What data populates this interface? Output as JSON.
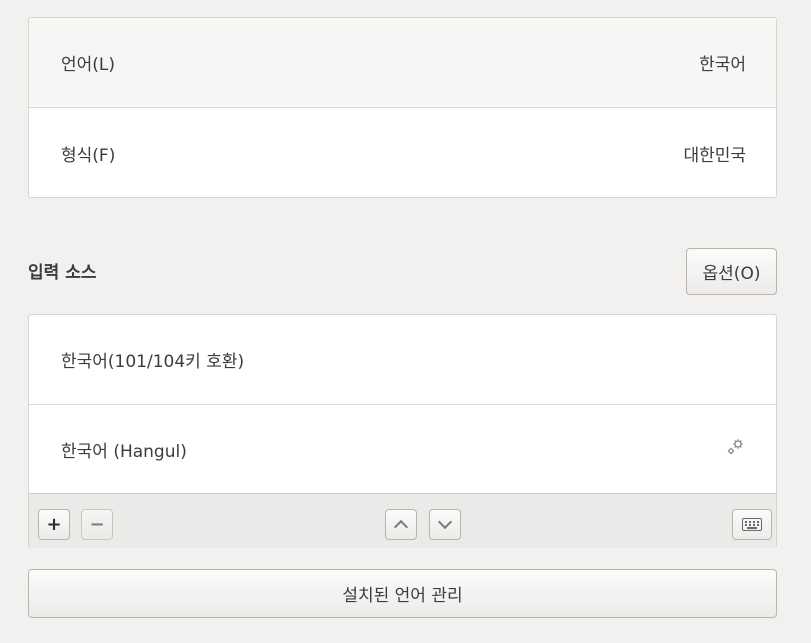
{
  "region": {
    "rows": [
      {
        "label": "언어(L)",
        "value": "한국어"
      },
      {
        "label": "형식(F)",
        "value": "대한민국"
      }
    ]
  },
  "input_sources": {
    "heading": "입력 소스",
    "options_label": "옵션(O)",
    "items": [
      {
        "label": "한국어(101/104키 호환)",
        "icon": "none"
      },
      {
        "label": "한국어 (Hangul)",
        "icon": "gear-icon"
      }
    ],
    "toolbar": {
      "add_label": "+",
      "remove_label": "−",
      "icons": [
        "chevron-up-icon",
        "chevron-down-icon",
        "keyboard-icon"
      ]
    }
  },
  "manage": {
    "label": "설치된 언어 관리"
  },
  "colors": {
    "background": "#f2f1f0",
    "panel": "#ffffff",
    "border": "#d7d5d2",
    "text": "#3c3c3c"
  }
}
